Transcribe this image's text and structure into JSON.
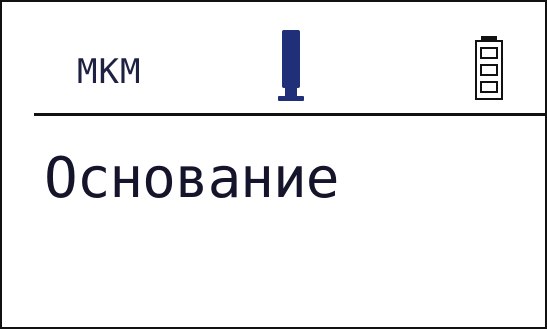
{
  "status_bar": {
    "unit_label": "МКМ",
    "probe_icon": "probe-icon",
    "battery_icon": "battery-icon",
    "battery_level_fraction": 1.0
  },
  "main": {
    "text": "Основание"
  },
  "colors": {
    "background": "#ffffff",
    "text": "#14142b",
    "probe": "#1f2f78",
    "divider": "#111111"
  }
}
